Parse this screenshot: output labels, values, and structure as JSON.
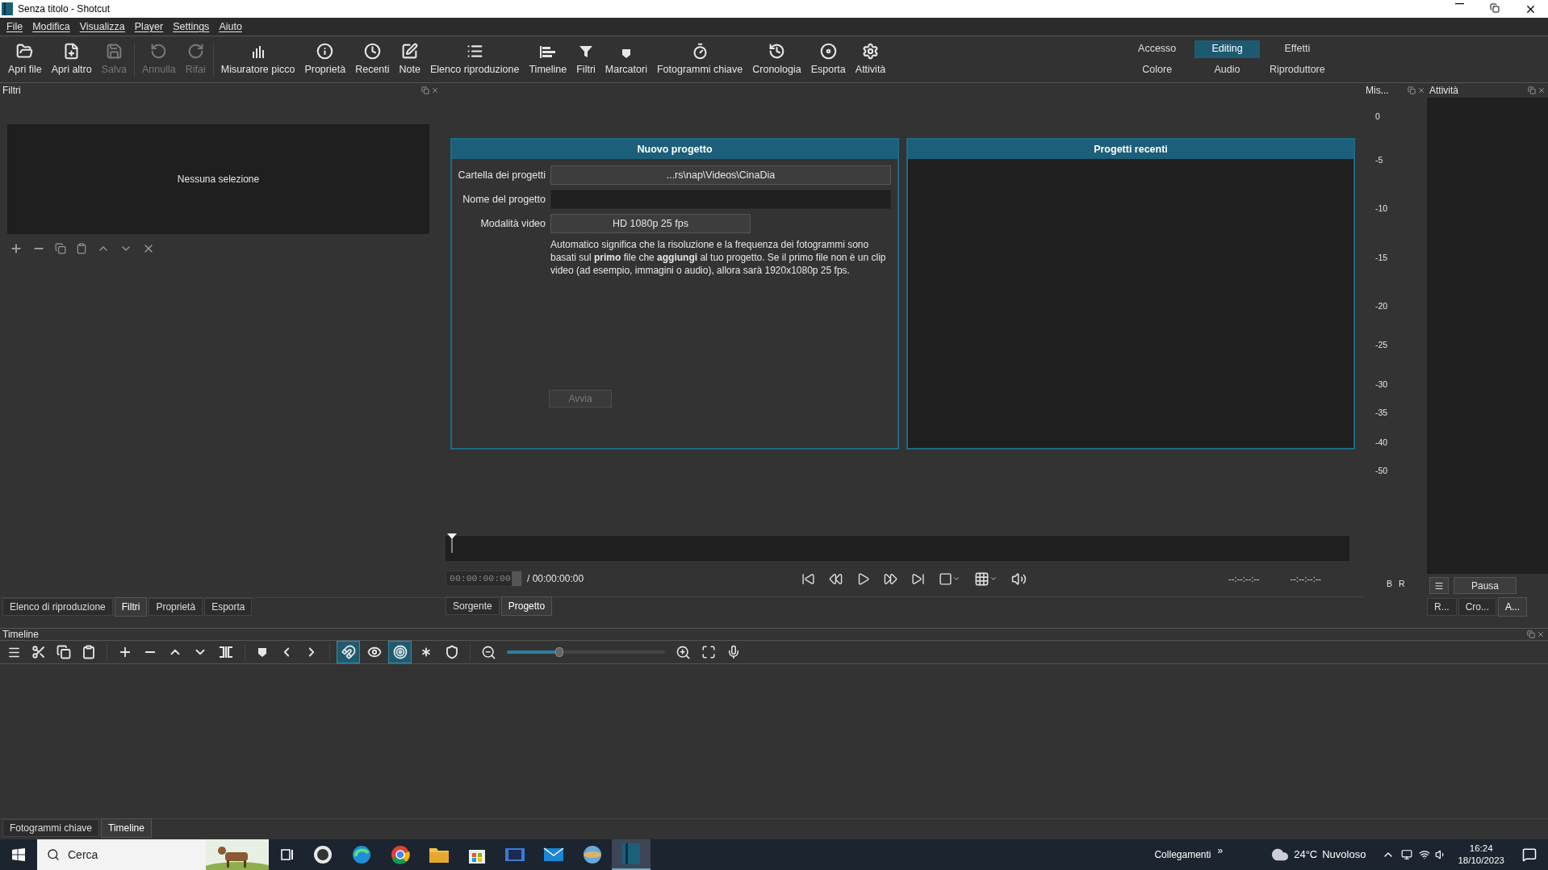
{
  "window": {
    "title": "Senza titolo - Shotcut"
  },
  "menu": [
    "File",
    "Modifica",
    "Visualizza",
    "Player",
    "Settings",
    "Aiuto"
  ],
  "toolbar": [
    {
      "label": "Apri file",
      "disabled": false
    },
    {
      "label": "Apri altro",
      "disabled": false
    },
    {
      "label": "Salva",
      "disabled": true
    },
    {
      "label": "Annulla",
      "disabled": true
    },
    {
      "label": "Rifai",
      "disabled": true
    },
    {
      "label": "Misuratore picco",
      "disabled": false
    },
    {
      "label": "Proprietà",
      "disabled": false
    },
    {
      "label": "Recenti",
      "disabled": false
    },
    {
      "label": "Note",
      "disabled": false
    },
    {
      "label": "Elenco riproduzione",
      "disabled": false
    },
    {
      "label": "Timeline",
      "disabled": false
    },
    {
      "label": "Filtri",
      "disabled": false
    },
    {
      "label": "Marcatori",
      "disabled": false
    },
    {
      "label": "Fotogrammi chiave",
      "disabled": false
    },
    {
      "label": "Cronologia",
      "disabled": false
    },
    {
      "label": "Esporta",
      "disabled": false
    },
    {
      "label": "Attività",
      "disabled": false
    }
  ],
  "workspaces": [
    {
      "label": "Accesso",
      "selected": false
    },
    {
      "label": "Editing",
      "selected": true
    },
    {
      "label": "Effetti",
      "selected": false
    },
    {
      "label": "Colore",
      "selected": false
    },
    {
      "label": "Audio",
      "selected": false
    },
    {
      "label": "Riproduttore",
      "selected": false
    }
  ],
  "filters_panel": {
    "title": "Filtri",
    "empty_text": "Nessuna selezione"
  },
  "left_tabs": [
    {
      "label": "Elenco di riproduzione",
      "selected": false
    },
    {
      "label": "Filtri",
      "selected": true
    },
    {
      "label": "Proprietà",
      "selected": false
    },
    {
      "label": "Esporta",
      "selected": false
    }
  ],
  "new_project": {
    "title": "Nuovo progetto",
    "folder_label": "Cartella dei progetti",
    "folder_value": "...rs\\nap\\Videos\\CinaDia",
    "name_label": "Nome del progetto",
    "mode_label": "Modalità video",
    "mode_value": "HD 1080p 25 fps",
    "description": "Automatico significa che la risoluzione e la frequenza dei fotogrammi sono basati sul **primo** file che **aggiungi** al tuo progetto. Se il primo file non è un clip video (ad esempio, immagini o audio), allora sarà 1920x1080p 25 fps.",
    "start_button": {
      "label": "Avvia",
      "disabled": true
    }
  },
  "recent_projects": {
    "title": "Progetti recenti"
  },
  "player": {
    "position": "00:00:00:00",
    "duration": "/ 00:00:00:00",
    "in_point": "--:--:--:--",
    "out_point": "--:--:--:--"
  },
  "player_tabs": [
    {
      "label": "Sorgente",
      "selected": false
    },
    {
      "label": "Progetto",
      "selected": true
    }
  ],
  "meter": {
    "title": "Mis...",
    "scale": [
      "0",
      "-5",
      "-10",
      "-15",
      "-20",
      "-25",
      "-30",
      "-35",
      "-40",
      "-50"
    ],
    "channels": [
      "B",
      "R"
    ]
  },
  "jobs": {
    "title": "Attività",
    "pause_button": "Pausa",
    "tabs": [
      {
        "label": "R...",
        "selected": false
      },
      {
        "label": "Cro...",
        "selected": false
      },
      {
        "label": "A...",
        "selected": true
      }
    ]
  },
  "timeline": {
    "title": "Timeline",
    "toggles": [
      {
        "on": true
      },
      {
        "on": false
      },
      {
        "on": true
      },
      {
        "on": false
      },
      {
        "on": false
      }
    ],
    "zoom": {
      "level": 0.33
    }
  },
  "bottom_tabs": [
    {
      "label": "Fotogrammi chiave",
      "selected": false
    },
    {
      "label": "Timeline",
      "selected": true
    }
  ],
  "taskbar": {
    "search_placeholder": "Cerca",
    "links": "Collegamenti",
    "links_chevron": "»",
    "temperature": "24°C",
    "weather": "Nuvoloso",
    "time": "16:24",
    "date": "18/10/2023"
  }
}
